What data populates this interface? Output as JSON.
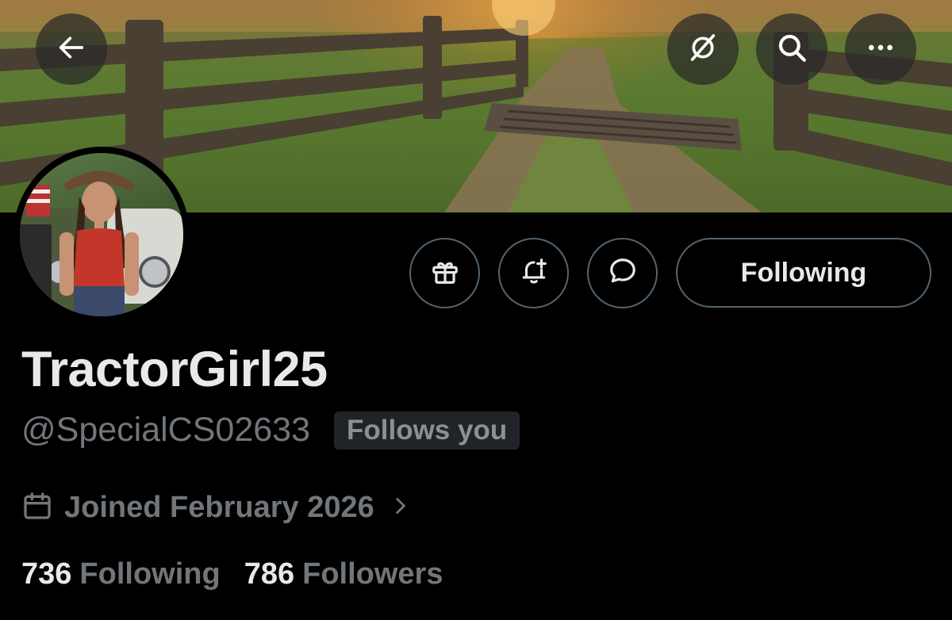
{
  "profile": {
    "display_name": "TractorGirl25",
    "handle": "@SpecialCS02633",
    "follows_you_badge": "Follows you",
    "joined": "Joined February 2026",
    "following_count": "736",
    "following_label": "Following",
    "followers_count": "786",
    "followers_label": "Followers"
  },
  "actions": {
    "follow_state_label": "Following"
  },
  "icons": {
    "back": "arrow-left-icon",
    "grok": "grok-icon",
    "search": "search-icon",
    "more": "more-horizontal-icon",
    "gift": "gift-icon",
    "notify": "bell-plus-icon",
    "message": "message-bubble-icon",
    "calendar": "calendar-icon",
    "chevron": "chevron-right-icon"
  },
  "colors": {
    "background": "#000000",
    "primary_text": "#e7e9ea",
    "secondary_text": "#71767b",
    "button_border": "#536471",
    "badge_bg": "#202327"
  }
}
